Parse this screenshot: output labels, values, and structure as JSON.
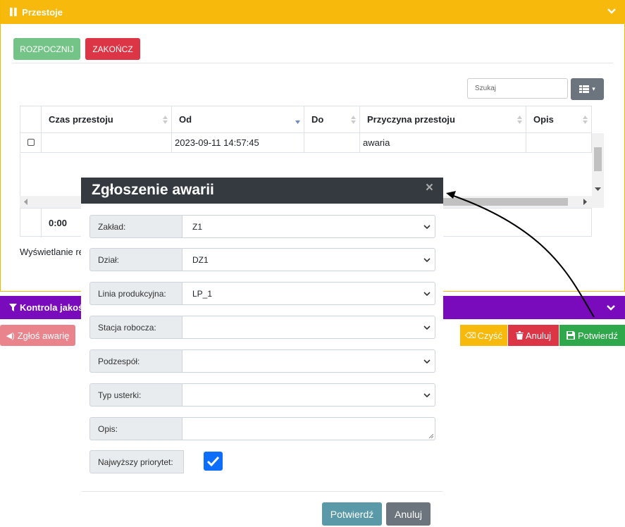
{
  "przestoje": {
    "title": "Przestoje",
    "start_label": "ROZPOCZNIJ",
    "end_label": "ZAKOŃCZ",
    "search_placeholder": "Szukaj",
    "columns": [
      "Czas przestoju",
      "Od",
      "Do",
      "Przyczyna przestoju",
      "Opis"
    ],
    "rows": [
      {
        "czas": "",
        "od": "2023-09-11 14:57:45",
        "do": "",
        "przyczyna": "awaria",
        "opis": ""
      }
    ],
    "footer_total": "0:00",
    "showing_text": "Wyświetlanie re"
  },
  "kontrola": {
    "title": "Kontrola jakośc",
    "zglos_label": "Zgłoś awarię",
    "czysc_label": "Czyść",
    "anuluj_label": "Anuluj",
    "potwierdz_label": "Potwierdź"
  },
  "modal": {
    "title": "Zgłoszenie awarii",
    "close": "×",
    "fields": [
      {
        "label": "Zakład:",
        "value": "Z1"
      },
      {
        "label": "Dział:",
        "value": "DZ1"
      },
      {
        "label": "Linia produkcyjna:",
        "value": "LP_1"
      },
      {
        "label": "Stacja robocza:",
        "value": ""
      },
      {
        "label": "Podzespół:",
        "value": ""
      },
      {
        "label": "Typ usterki:",
        "value": ""
      },
      {
        "label": "Opis:",
        "value": ""
      }
    ],
    "priority_label": "Najwyższy priorytet:",
    "priority_checked": true,
    "confirm_label": "Potwierdź",
    "cancel_label": "Anuluj"
  },
  "colors": {
    "przestoje_header": "#f7b90b",
    "kontrola_header": "#7a0bbd",
    "modal_header": "#343a40",
    "success": "#74c487",
    "danger": "#dc3545"
  }
}
